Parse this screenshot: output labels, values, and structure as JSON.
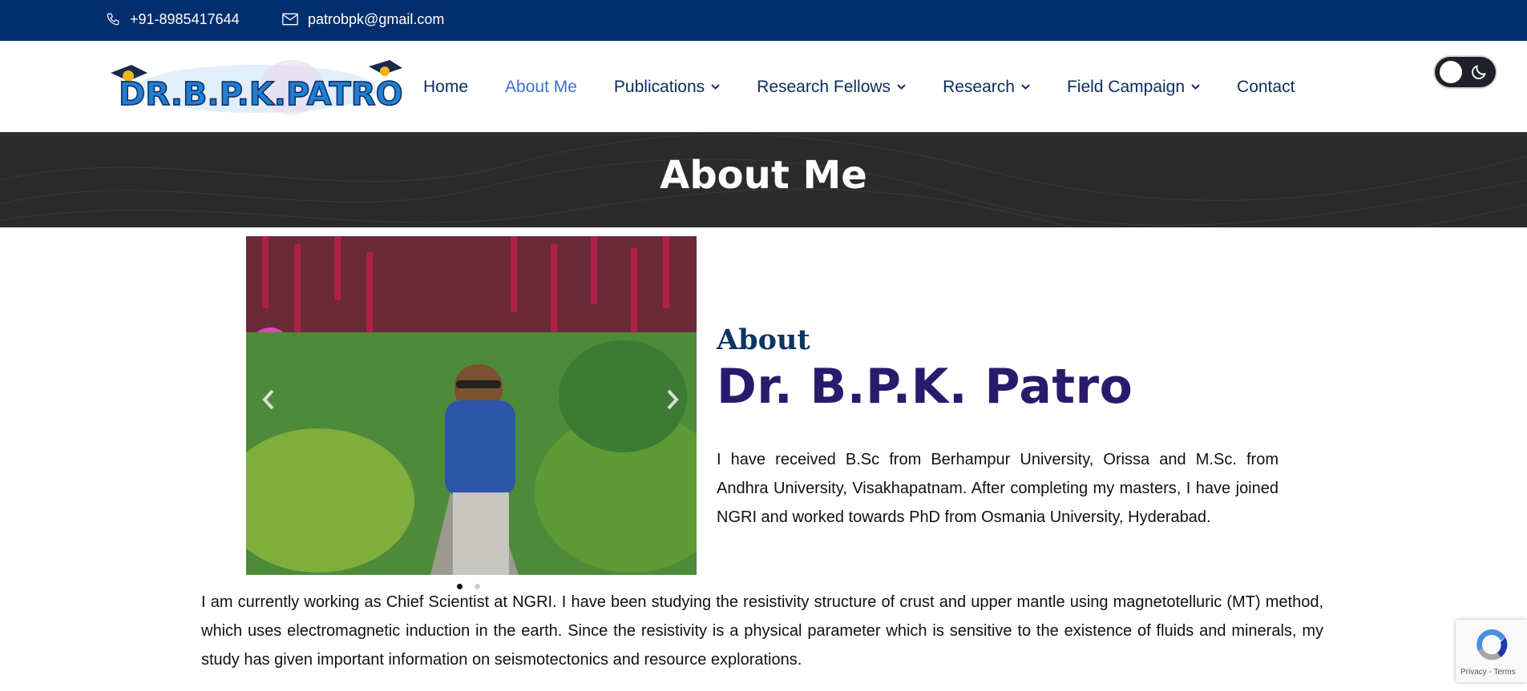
{
  "topbar": {
    "phone": "+91-8985417644",
    "email": "patrobpk@gmail.com",
    "phone_icon": "phone-icon",
    "email_icon": "envelope-icon"
  },
  "logo": {
    "text": "DR.B.P.K.PATRO"
  },
  "nav": {
    "items": [
      {
        "label": "Home",
        "dropdown": false,
        "active": false
      },
      {
        "label": "About Me",
        "dropdown": false,
        "active": true
      },
      {
        "label": "Publications",
        "dropdown": true,
        "active": false
      },
      {
        "label": "Research Fellows",
        "dropdown": true,
        "active": false
      },
      {
        "label": "Research",
        "dropdown": true,
        "active": false
      },
      {
        "label": "Field Campaign",
        "dropdown": true,
        "active": false
      },
      {
        "label": "Contact",
        "dropdown": false,
        "active": false
      }
    ]
  },
  "theme_toggle": {
    "icon": "moon-icon",
    "state": "light"
  },
  "banner": {
    "title": "About Me"
  },
  "carousel": {
    "slides": 2,
    "active_slide": 1,
    "prev_icon": "chevron-left-icon",
    "next_icon": "chevron-right-icon"
  },
  "about": {
    "label": "About",
    "name": "Dr. B.P.K. Patro",
    "paragraph1": "I have received B.Sc from Berhampur University, Orissa and M.Sc. from Andhra University, Visakhapatnam. After completing my masters, I have joined NGRI and worked towards PhD from Osmania University, Hyderabad.",
    "paragraph2": "I am currently working as Chief Scientist at NGRI. I have been studying the resistivity structure of crust and upper mantle using magnetotelluric (MT) method, which uses electromagnetic induction in the earth. Since the resistivity is a physical parameter which is sensitive to the existence of fluids and minerals, my study has given important information on seismotectonics and resource explorations."
  },
  "recaptcha": {
    "terms": "Privacy - Terms"
  },
  "colors": {
    "topbar_bg": "#022e6e",
    "nav_text": "#0b2d5e",
    "nav_active": "#3a72d6",
    "banner_bg": "#2b2b2b",
    "name_color": "#2a1a6b"
  }
}
